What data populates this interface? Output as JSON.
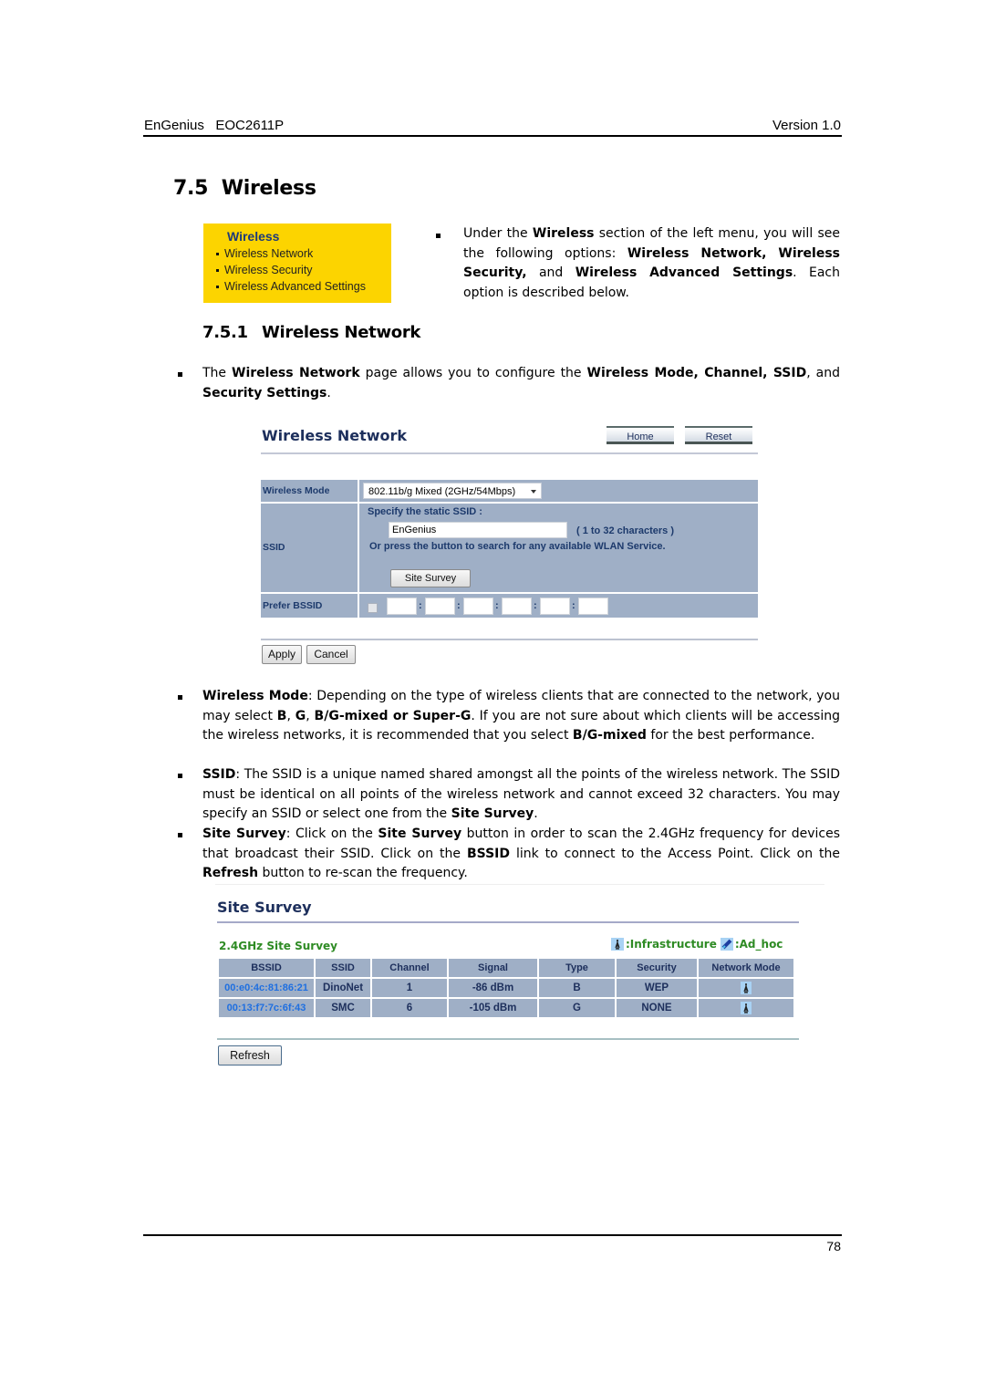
{
  "header": {
    "left": "EnGenius   EOC2611P",
    "right": "Version 1.0"
  },
  "section": {
    "title": "7.5  Wireless"
  },
  "left_menu": {
    "title": "Wireless",
    "items": [
      "Wireless Network",
      "Wireless Security",
      "Wireless Advanced Settings"
    ],
    "background": "#fcd400",
    "title_color": "#1d3a7a"
  },
  "intro": {
    "t1": "Under the ",
    "b1": "Wireless",
    "t2": " section of the left menu, you will see the following options: ",
    "b2": "Wireless Network, Wireless Security,",
    "t3": " and ",
    "b3": "Wireless Advanced Settings",
    "t4": ". Each option is described below."
  },
  "subsection": {
    "number": "7.5.1",
    "title": "Wireless Network"
  },
  "wn_intro": {
    "t1": "The ",
    "b1": "Wireless Network",
    "t2": " page allows you to configure the ",
    "b2": "Wireless Mode, Channel, SSID",
    "t3": ", and ",
    "b3": "Security Settings",
    "t4": "."
  },
  "wireless_network_page": {
    "title": "Wireless Network",
    "home_button": "Home",
    "reset_button": "Reset",
    "rows": {
      "mode_label": "Wireless Mode",
      "mode_value": "802.11b/g Mixed (2GHz/54Mbps)",
      "ssid_label": "SSID",
      "ssid_prompt": "Specify the static SSID  :",
      "ssid_value": "EnGenius",
      "ssid_hint": "( 1 to 32 characters )",
      "ssid_search_text": "Or press the button to search for any available WLAN Service.",
      "site_survey_button": "Site Survey",
      "prefer_bssid_label": "Prefer BSSID",
      "prefer_bssid_checked": false,
      "bssid_octets": [
        "",
        "",
        "",
        "",
        "",
        ""
      ],
      "separator": ":"
    },
    "apply_button": "Apply",
    "cancel_button": "Cancel",
    "row_color": "#9fafc6"
  },
  "descriptions": [
    {
      "term": "Wireless Mode",
      "t1": ": Depending on the type of wireless clients that are connected to the network, you may select ",
      "b1": "B",
      "t2": ", ",
      "b2": "G",
      "t3": ", ",
      "b3": "B/G-mixed or Super-G",
      "t4": ". If you are not sure about which clients will be accessing the wireless networks, it is recommended that you select ",
      "b4": "B/G-mixed",
      "t5": " for the best performance."
    },
    {
      "term": "SSID",
      "t1": ": The SSID is a unique named shared amongst all the points of the wireless network. The SSID must be identical on all points of the wireless network and cannot exceed 32 characters. You may specify an SSID or select one from the ",
      "b1": "Site Survey",
      "t2": "."
    },
    {
      "term": "Site Survey",
      "t1": ": Click on the ",
      "b1": "Site Survey",
      "t2": " button in order to scan the 2.4GHz frequency for devices that broadcast their SSID. Click on the ",
      "b2": "BSSID",
      "t3": " link to connect to the Access Point. Click on the ",
      "b3": "Refresh",
      "t4": " button to re-scan the frequency."
    }
  ],
  "site_survey_page": {
    "title": "Site Survey",
    "subtitle": "2.4GHz Site Survey",
    "legend_infrastructure": ":Infrastructure",
    "legend_adhoc": ":Ad_hoc",
    "columns": [
      "BSSID",
      "SSID",
      "Channel",
      "Signal",
      "Type",
      "Security",
      "Network Mode"
    ],
    "rows": [
      {
        "bssid": "00:e0:4c:81:86:21",
        "ssid": "DinoNet",
        "channel": "1",
        "signal": "-86 dBm",
        "type": "B",
        "security": "WEP",
        "mode_icon": "infrastructure-icon"
      },
      {
        "bssid": "00:13:f7:7c:6f:43",
        "ssid": "SMC",
        "channel": "6",
        "signal": "-105 dBm",
        "type": "G",
        "security": "NONE",
        "mode_icon": "infrastructure-icon"
      }
    ],
    "refresh_button": "Refresh",
    "subtitle_color": "#2e8b24",
    "link_color": "#1f6fe0"
  },
  "footer": {
    "page_number": "78"
  }
}
